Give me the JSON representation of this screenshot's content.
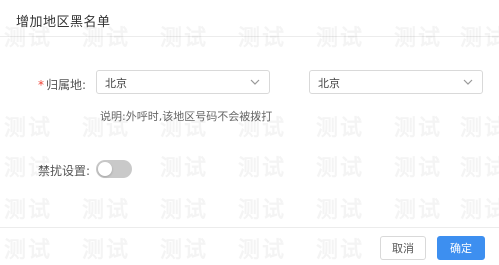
{
  "dialog": {
    "title": "增加地区黑名单"
  },
  "form": {
    "region": {
      "required_mark": "*",
      "label": "归属地:",
      "province_value": "北京",
      "city_value": "北京"
    },
    "hint": "说明:外呼时,该地区号码不会被拨打",
    "dnd": {
      "label": "禁扰设置:",
      "enabled": false
    }
  },
  "footer": {
    "cancel_label": "取消",
    "ok_label": "确定"
  },
  "watermark": {
    "text": "测试"
  },
  "colors": {
    "primary": "#3d8ff0",
    "required": "#f04134",
    "switch_off": "#c9c9c9"
  },
  "icons": {
    "select_arrow": "chevron-down-icon"
  }
}
